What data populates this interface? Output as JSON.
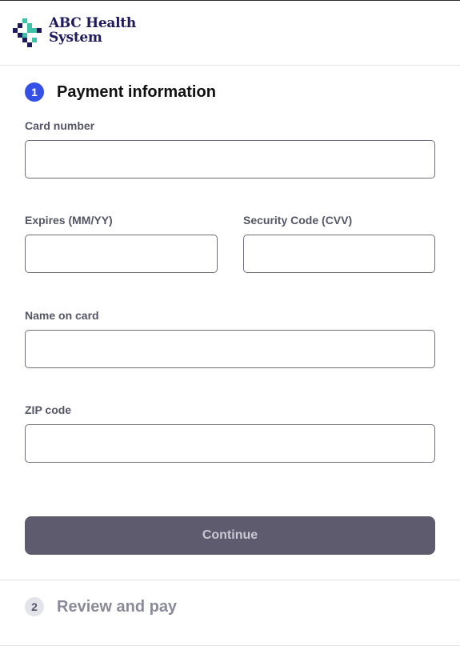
{
  "brand": {
    "logo_line1": "ABC Health",
    "logo_line2": "System",
    "colors": {
      "navy": "#1f1b5b",
      "teal": "#3ec2a7"
    }
  },
  "step1": {
    "number": "1",
    "title": "Payment information"
  },
  "form": {
    "card_number": {
      "label": "Card number",
      "value": ""
    },
    "expires": {
      "label": "Expires (MM/YY)",
      "value": ""
    },
    "cvv": {
      "label": "Security Code (CVV)",
      "value": ""
    },
    "name_on_card": {
      "label": "Name on card",
      "value": ""
    },
    "zip": {
      "label": "ZIP code",
      "value": ""
    }
  },
  "continue_button": {
    "label": "Continue"
  },
  "step2": {
    "number": "2",
    "title": "Review and pay"
  },
  "colors": {
    "accent": "#3450e6",
    "button_bg": "#5e5b6f",
    "button_text": "#c9c8d2"
  }
}
